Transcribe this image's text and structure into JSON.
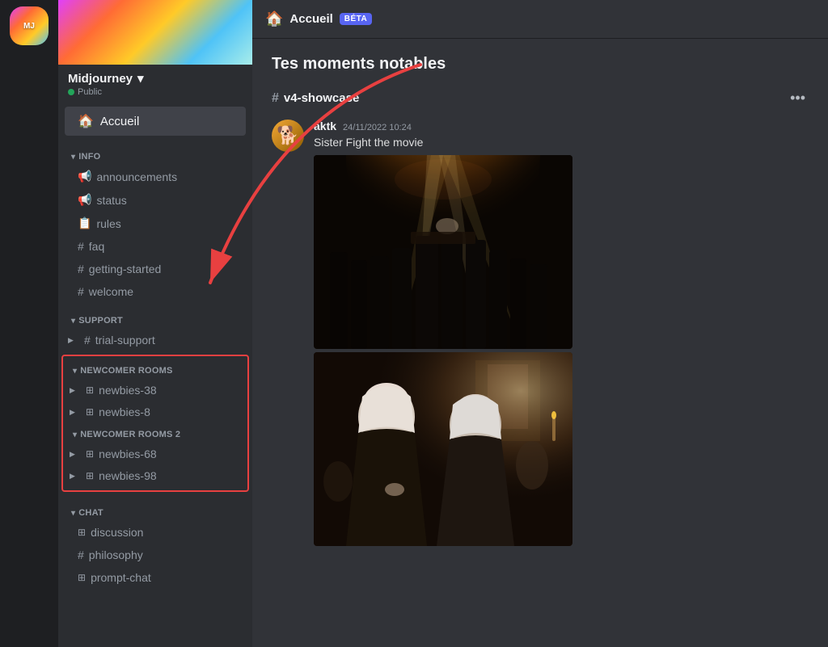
{
  "server": {
    "name": "Midjourney",
    "status": "Public",
    "chevron": "▾"
  },
  "sidebar": {
    "accueil_label": "Accueil",
    "sections": [
      {
        "id": "info",
        "label": "INFO",
        "channels": [
          {
            "id": "announcements",
            "name": "announcements",
            "icon": "📢",
            "type": "announcement"
          },
          {
            "id": "status",
            "name": "status",
            "icon": "📢",
            "type": "announcement"
          },
          {
            "id": "rules",
            "name": "rules",
            "icon": "📋",
            "type": "rules"
          },
          {
            "id": "faq",
            "name": "faq",
            "icon": "#",
            "type": "text"
          },
          {
            "id": "getting-started",
            "name": "getting-started",
            "icon": "#",
            "type": "text"
          },
          {
            "id": "welcome",
            "name": "welcome",
            "icon": "#",
            "type": "text"
          }
        ]
      },
      {
        "id": "support",
        "label": "SUPPORT",
        "channels": [
          {
            "id": "trial-support",
            "name": "trial-support",
            "icon": "#",
            "type": "text",
            "has_arrow": true
          }
        ]
      }
    ],
    "newcomer_sections": [
      {
        "id": "newcomer-rooms",
        "label": "NEWCOMER ROOMS",
        "channels": [
          {
            "id": "newbies-38",
            "name": "newbies-38",
            "icon": "🔀",
            "type": "voice",
            "has_arrow": true
          },
          {
            "id": "newbies-8",
            "name": "newbies-8",
            "icon": "🔀",
            "type": "voice",
            "has_arrow": true
          }
        ]
      },
      {
        "id": "newcomer-rooms-2",
        "label": "NEWCOMER ROOMS 2",
        "channels": [
          {
            "id": "newbies-68",
            "name": "newbies-68",
            "icon": "🔀",
            "type": "voice",
            "has_arrow": true
          },
          {
            "id": "newbies-98",
            "name": "newbies-98",
            "icon": "🔀",
            "type": "voice",
            "has_arrow": true
          }
        ]
      }
    ],
    "chat_section": {
      "label": "CHAT",
      "channels": [
        {
          "id": "discussion",
          "name": "discussion",
          "icon": "🔀",
          "type": "voice"
        },
        {
          "id": "philosophy",
          "name": "philosophy",
          "icon": "#",
          "type": "text"
        },
        {
          "id": "prompt-chat",
          "name": "prompt-chat",
          "icon": "🔀",
          "type": "voice"
        }
      ]
    }
  },
  "main": {
    "header_icon": "🏠",
    "title": "Accueil",
    "beta_label": "BÉTA",
    "moments_title": "Tes moments notables",
    "showcase_channel": "v4-showcase",
    "more_icon": "•••",
    "message": {
      "author": "aktk",
      "time": "24/11/2022 10:24",
      "text": "Sister Fight the movie",
      "avatar_emoji": "🐕"
    }
  }
}
